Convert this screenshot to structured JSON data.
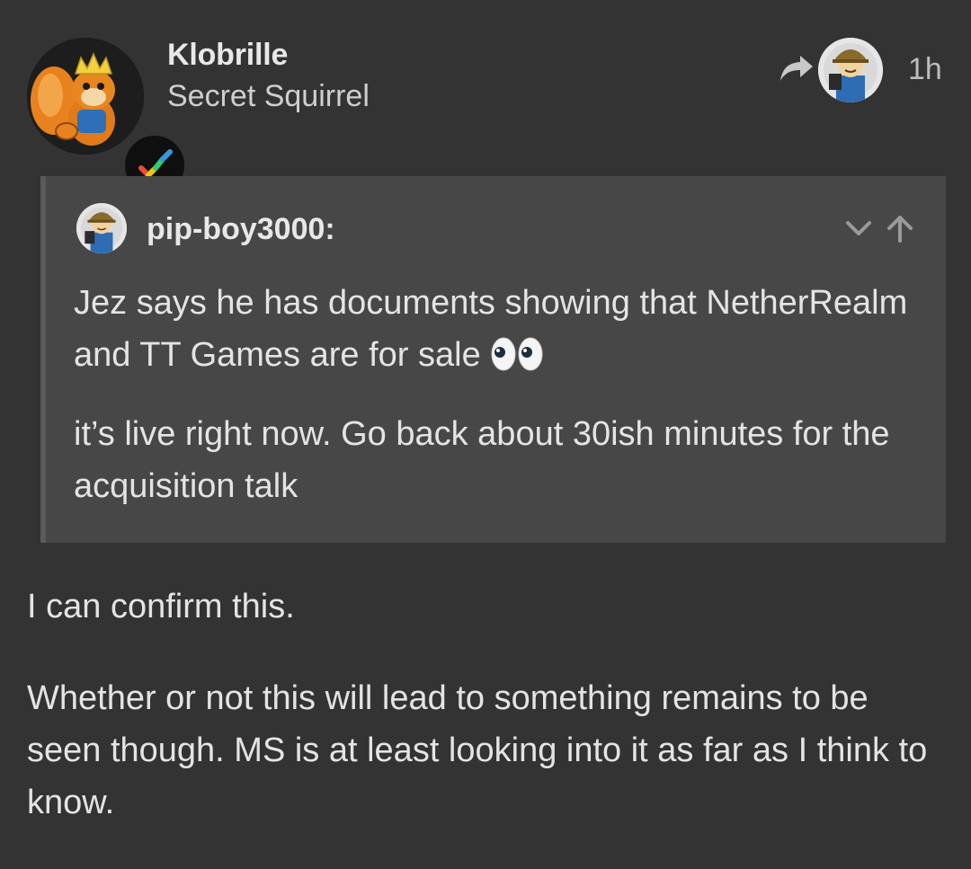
{
  "post": {
    "author": {
      "username": "Klobrille",
      "title": "Secret Squirrel",
      "avatar_icon": "king-squirrel-avatar",
      "badge_icon": "multicolor-checkmark-icon"
    },
    "reply_to": {
      "icon": "reply-arrow-icon",
      "avatar_icon": "vault-boy-avatar"
    },
    "timestamp": "1h",
    "quote": {
      "author": "pip-boy3000:",
      "avatar_icon": "vault-boy-avatar",
      "controls": [
        "chevron-down-icon",
        "arrow-up-icon"
      ],
      "paragraph1": "Jez says he has documents showing that NetherRealm and TT Games are for sale",
      "emoji": "eyes-emoji",
      "paragraph2": "it’s live right now. Go back about 30ish minutes for the acquisition talk"
    },
    "body": {
      "paragraph1": "I can confirm this.",
      "paragraph2": "Whether or not this will lead to something remains to be seen though. MS is at least looking into it as far as I think to know."
    }
  },
  "colors": {
    "background": "#333333",
    "quote_background": "#474747",
    "quote_border": "#5a5a5a",
    "text": "#e4e4e4",
    "muted_text": "#bdbdbd"
  }
}
